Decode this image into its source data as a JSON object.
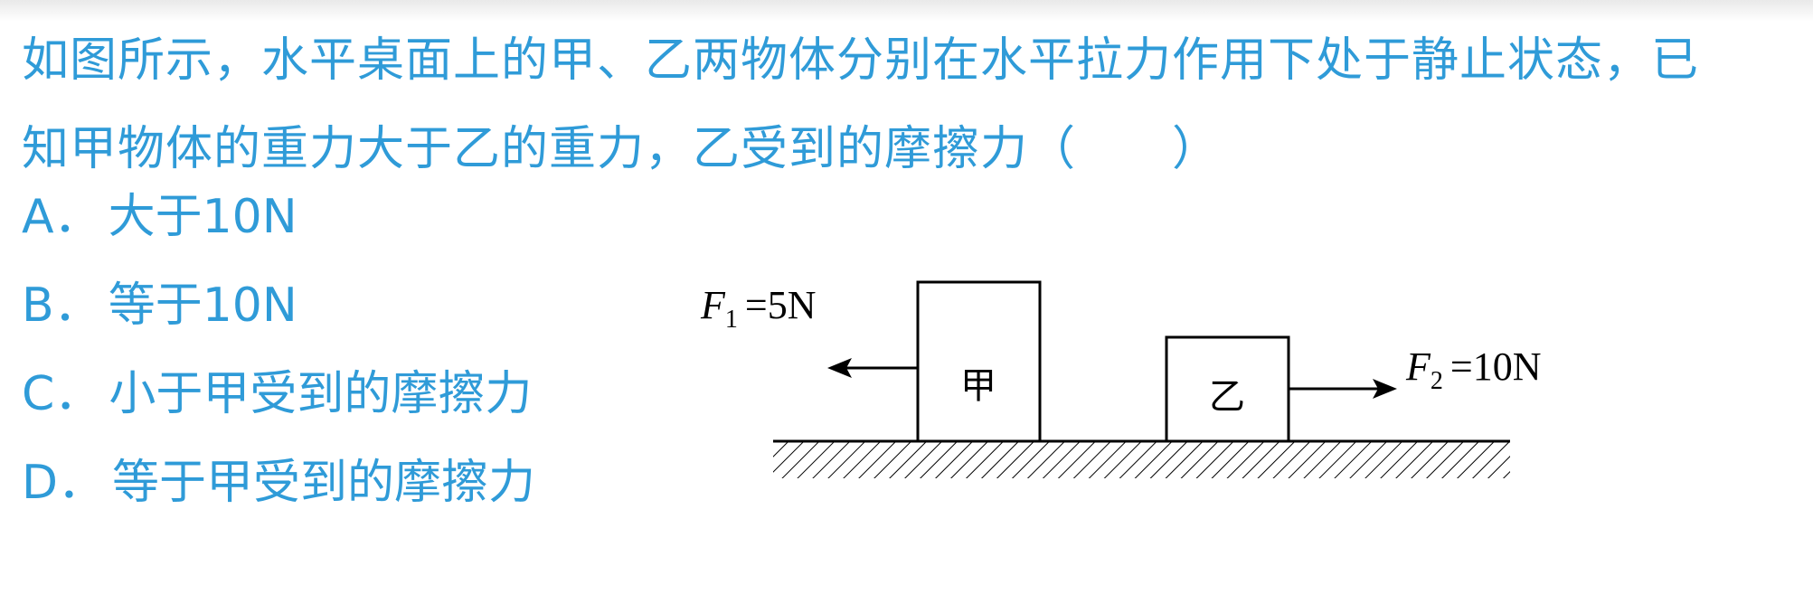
{
  "question": {
    "line1": "如图所示，水平桌面上的甲、乙两物体分别在水平拉力作用下处于静止状态，已",
    "line2": "知甲物体的重力大于乙的重力，乙受到的摩擦力（　　）"
  },
  "options": [
    {
      "letter": "A．",
      "text": "大于10N"
    },
    {
      "letter": "B．",
      "text": "等于10N"
    },
    {
      "letter": "C．",
      "text": "小于甲受到的摩擦力"
    },
    {
      "letter": "D．",
      "text": "等于甲受到的摩擦力"
    }
  ],
  "figure": {
    "block_left_label": "甲",
    "block_right_label": "乙",
    "force1": {
      "symbol": "F",
      "subscript": "1",
      "value": "=5N"
    },
    "force2": {
      "symbol": "F",
      "subscript": "2",
      "value": "=10N"
    }
  },
  "colors": {
    "text": "#2f9bd8",
    "diagram": "#000000"
  }
}
